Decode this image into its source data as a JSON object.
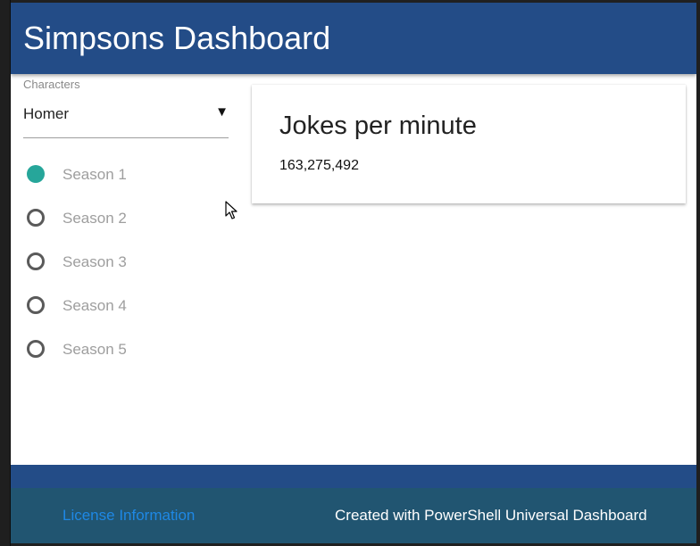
{
  "header": {
    "title": "Simpsons Dashboard"
  },
  "sidebar": {
    "select": {
      "label": "Characters",
      "value": "Homer",
      "arrow": "▼"
    },
    "radios": [
      {
        "label": "Season 1",
        "checked": true
      },
      {
        "label": "Season 2",
        "checked": false
      },
      {
        "label": "Season 3",
        "checked": false
      },
      {
        "label": "Season 4",
        "checked": false
      },
      {
        "label": "Season 5",
        "checked": false
      }
    ]
  },
  "card": {
    "title": "Jokes per minute",
    "value": "163,275,492"
  },
  "footer": {
    "license_link": "License Information",
    "credit": "Created with PowerShell Universal Dashboard"
  },
  "colors": {
    "header_bg": "#234c87",
    "footer_bg": "#215571",
    "radio_checked": "#26a69a",
    "link": "#1e88e5"
  },
  "icons": {
    "cursor": "mouse-pointer-icon",
    "dropdown": "triangle-down-icon"
  }
}
